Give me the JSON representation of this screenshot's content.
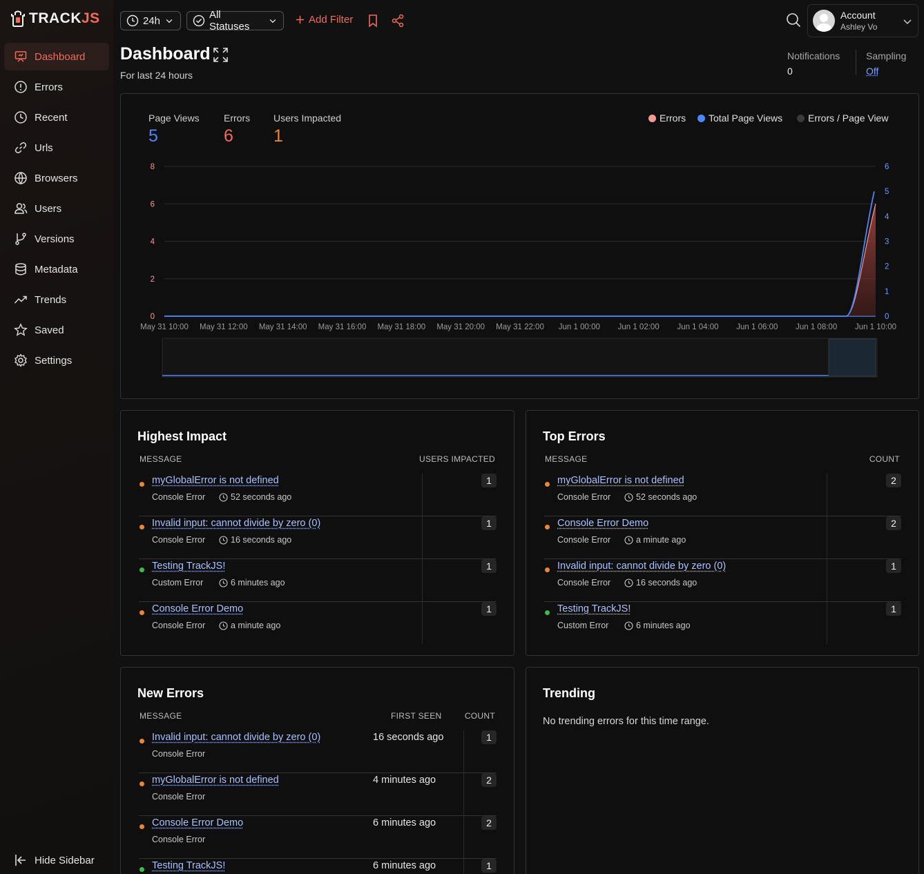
{
  "brand": {
    "logo_text_a": "TRACK",
    "logo_text_b": "JS",
    "accent": "#f26b5b"
  },
  "topbar": {
    "timerange": "24h",
    "status_filter": "All Statuses",
    "add_filter": "Add Filter",
    "search_icon": "search-icon",
    "account": {
      "label": "Account",
      "user": "Ashley Vo"
    }
  },
  "sidebar": {
    "items": [
      {
        "label": "Dashboard",
        "icon": "dashboard-icon",
        "active": true
      },
      {
        "label": "Errors",
        "icon": "alert-circle-icon"
      },
      {
        "label": "Recent",
        "icon": "clock-icon"
      },
      {
        "label": "Urls",
        "icon": "link-icon"
      },
      {
        "label": "Browsers",
        "icon": "globe-icon"
      },
      {
        "label": "Users",
        "icon": "users-icon"
      },
      {
        "label": "Versions",
        "icon": "branch-icon"
      },
      {
        "label": "Metadata",
        "icon": "database-icon"
      },
      {
        "label": "Trends",
        "icon": "trend-icon"
      },
      {
        "label": "Saved",
        "icon": "star-icon"
      },
      {
        "label": "Settings",
        "icon": "gear-icon"
      }
    ],
    "hide_label": "Hide Sidebar"
  },
  "header": {
    "title": "Dashboard",
    "subtitle": "For last 24 hours",
    "notifications_label": "Notifications",
    "notifications_value": "0",
    "sampling_label": "Sampling",
    "sampling_value": "Off"
  },
  "summary": {
    "page_views_label": "Page Views",
    "page_views": "5",
    "errors_label": "Errors",
    "errors": "6",
    "users_label": "Users Impacted",
    "users": "1",
    "colors": {
      "page_views": "#4f86f7",
      "errors": "#f26b5b",
      "users": "#e8873a"
    }
  },
  "chart_data": {
    "type": "area",
    "legend": [
      {
        "name": "Errors",
        "color": "#f59a93"
      },
      {
        "name": "Total Page Views",
        "color": "#4f86f7"
      },
      {
        "name": "Errors / Page View",
        "color": "#3a3a3a"
      }
    ],
    "legend_position": "top-right",
    "x_ticks": [
      "May 31 10:00",
      "May 31 12:00",
      "May 31 14:00",
      "May 31 16:00",
      "May 31 18:00",
      "May 31 20:00",
      "May 31 22:00",
      "Jun 1 00:00",
      "Jun 1 02:00",
      "Jun 1 04:00",
      "Jun 1 06:00",
      "Jun 1 08:00",
      "Jun 1 10:00"
    ],
    "y_left_ticks": [
      0,
      2,
      4,
      6,
      8
    ],
    "y_left_range": [
      0,
      8
    ],
    "y_right_ticks": [
      0,
      1,
      2,
      3,
      4,
      5,
      6
    ],
    "y_right_range": [
      0,
      6
    ],
    "grid": true,
    "series": [
      {
        "name": "Errors",
        "axis": "left",
        "x": [
          "Jun 1 09:00",
          "Jun 1 10:00"
        ],
        "values": [
          0,
          6
        ]
      },
      {
        "name": "Total Page Views",
        "axis": "right",
        "x": [
          "Jun 1 09:00",
          "Jun 1 10:00"
        ],
        "values": [
          0,
          5
        ]
      }
    ]
  },
  "highest_impact": {
    "title": "Highest Impact",
    "col_message": "MESSAGE",
    "col_users": "USERS IMPACTED",
    "rows": [
      {
        "message": "myGlobalError is not defined",
        "type": "Console Error",
        "time": "52 seconds ago",
        "value": "1",
        "color": "#e8873a"
      },
      {
        "message": "Invalid input: cannot divide by zero (0)",
        "type": "Console Error",
        "time": "16 seconds ago",
        "value": "1",
        "color": "#e8873a"
      },
      {
        "message": "Testing TrackJS!",
        "type": "Custom Error",
        "time": "6 minutes ago",
        "value": "1",
        "color": "#3fb950"
      },
      {
        "message": "Console Error Demo",
        "type": "Console Error",
        "time": "a minute ago",
        "value": "1",
        "color": "#e8873a"
      }
    ]
  },
  "top_errors": {
    "title": "Top Errors",
    "col_message": "MESSAGE",
    "col_count": "COUNT",
    "rows": [
      {
        "message": "myGlobalError is not defined",
        "type": "Console Error",
        "time": "52 seconds ago",
        "value": "2",
        "color": "#e8873a"
      },
      {
        "message": "Console Error Demo",
        "type": "Console Error",
        "time": "a minute ago",
        "value": "2",
        "color": "#e8873a"
      },
      {
        "message": "Invalid input: cannot divide by zero (0)",
        "type": "Console Error",
        "time": "16 seconds ago",
        "value": "1",
        "color": "#e8873a"
      },
      {
        "message": "Testing TrackJS!",
        "type": "Custom Error",
        "time": "6 minutes ago",
        "value": "1",
        "color": "#3fb950"
      }
    ]
  },
  "new_errors": {
    "title": "New Errors",
    "col_message": "MESSAGE",
    "col_first_seen": "FIRST SEEN",
    "col_count": "COUNT",
    "rows": [
      {
        "message": "Invalid input: cannot divide by zero (0)",
        "type": "Console Error",
        "first_seen": "16 seconds ago",
        "value": "1",
        "color": "#e8873a"
      },
      {
        "message": "myGlobalError is not defined",
        "type": "Console Error",
        "first_seen": "4 minutes ago",
        "value": "2",
        "color": "#e8873a"
      },
      {
        "message": "Console Error Demo",
        "type": "Console Error",
        "first_seen": "6 minutes ago",
        "value": "2",
        "color": "#e8873a"
      },
      {
        "message": "Testing TrackJS!",
        "type": "",
        "first_seen": "6 minutes ago",
        "value": "1",
        "color": "#3fb950"
      }
    ]
  },
  "trending": {
    "title": "Trending",
    "empty": "No trending errors for this time range."
  }
}
